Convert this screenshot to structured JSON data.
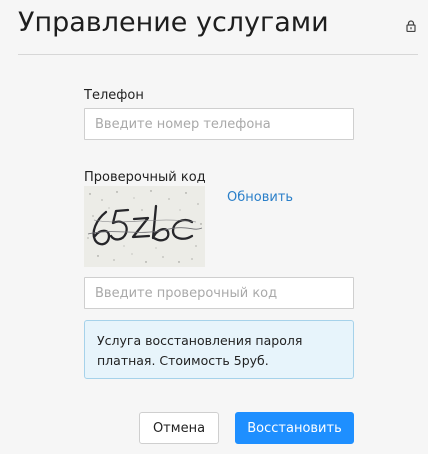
{
  "header": {
    "title": "Управление услугами",
    "icon": "lock-icon"
  },
  "form": {
    "phone": {
      "label": "Телефон",
      "value": "",
      "placeholder": "Введите номер телефона"
    },
    "captcha": {
      "label": "Проверочный код",
      "image_text": "65zbc",
      "refresh_label": "Обновить",
      "input_value": "",
      "input_placeholder": "Введите проверочный код"
    },
    "notice": {
      "line1": "Услуга восстановления пароля",
      "line2": "платная. Стоимость 5руб."
    }
  },
  "actions": {
    "cancel_label": "Отмена",
    "submit_label": "Восстановить"
  },
  "colors": {
    "primary": "#1e8fff",
    "link": "#2a7fc9",
    "notice_bg": "#e7f4fb",
    "notice_border": "#a6d2ea"
  }
}
